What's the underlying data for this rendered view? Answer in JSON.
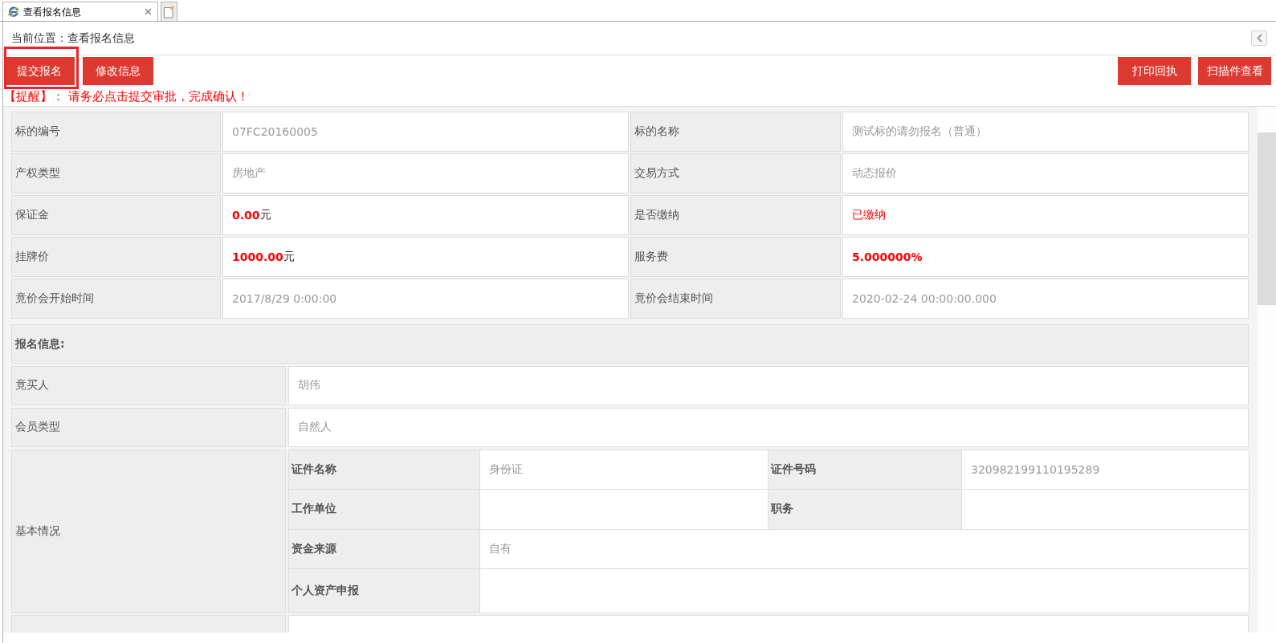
{
  "browser_tabs": [
    {
      "title": "查看报名信息",
      "selected": true
    }
  ],
  "breadcrumb": "当前位置：查看报名信息",
  "toolbar": {
    "left_buttons": [
      {
        "label": "提交报名",
        "highlighted": true
      },
      {
        "label": "修改信息",
        "highlighted": false
      }
    ],
    "right_buttons": [
      {
        "label": "打印回执"
      },
      {
        "label": "扫描件查看"
      }
    ]
  },
  "reminder": "【提醒】： 请务必点击提交审批，完成确认！",
  "listing_table": {
    "rows": [
      [
        {
          "label": "标的编号",
          "value": "07FC20160005",
          "kind": "plain"
        },
        {
          "label": "标的名称",
          "value": "测试标的请勿报名（普通）",
          "kind": "plain"
        }
      ],
      [
        {
          "label": "产权类型",
          "value": "房地产",
          "kind": "plain"
        },
        {
          "label": "交易方式",
          "value": "动态报价",
          "kind": "plain"
        }
      ],
      [
        {
          "label": "保证金",
          "value": "**0.00**元",
          "kind": "amount"
        },
        {
          "label": "是否缴纳",
          "value": "已缴纳",
          "kind": "status"
        }
      ],
      [
        {
          "label": "挂牌价",
          "value": "**1000.00**元",
          "kind": "amount"
        },
        {
          "label": "服务费",
          "value": "5.000000%",
          "kind": "rate"
        }
      ],
      [
        {
          "label": "竟价会开始时间",
          "value": "2017/8/29 0:00:00",
          "kind": "plain"
        },
        {
          "label": "竟价会结束时间",
          "value": "2020-02-24 00:00:00.000",
          "kind": "plain"
        }
      ]
    ]
  },
  "registration": {
    "title": "报名信息:",
    "fields": [
      {
        "label": "竟买人",
        "value": "胡伟"
      },
      {
        "label": "会员类型",
        "value": "自然人"
      }
    ],
    "basic_info": {
      "label": "基本情况",
      "rows": [
        [
          {
            "label": "证件名称",
            "value": "身份证"
          },
          {
            "label": "证件号码",
            "value": "320982199110195289"
          }
        ],
        [
          {
            "label": "工作单位"
          },
          {
            "label": "职务"
          }
        ],
        [
          {
            "label": "资金来源",
            "value": "自有"
          }
        ],
        [
          {
            "label": "个人资产申报"
          }
        ]
      ]
    }
  }
}
